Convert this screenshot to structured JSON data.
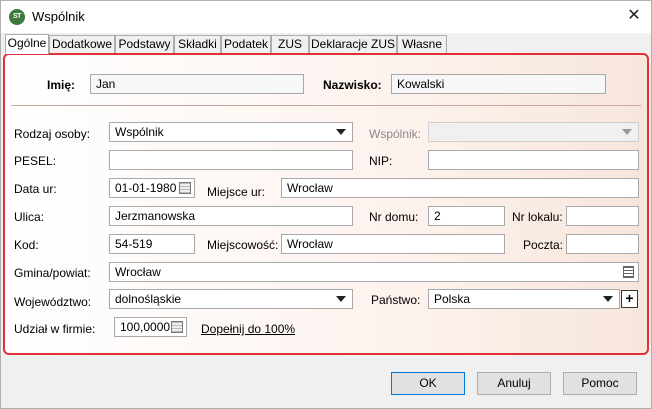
{
  "window": {
    "title": "Wspólnik",
    "icon_text": "ST"
  },
  "tabs": [
    {
      "label": "Ogólne"
    },
    {
      "label": "Dodatkowe"
    },
    {
      "label": "Podstawy"
    },
    {
      "label": "Składki"
    },
    {
      "label": "Podatek"
    },
    {
      "label": "ZUS"
    },
    {
      "label": "Deklaracje ZUS"
    },
    {
      "label": "Własne"
    }
  ],
  "form": {
    "imie": {
      "label": "Imię:",
      "value": "Jan"
    },
    "nazwisko": {
      "label": "Nazwisko:",
      "value": "Kowalski"
    },
    "rodzaj_osoby": {
      "label": "Rodzaj osoby:",
      "value": "Wspólnik"
    },
    "wspolnik": {
      "label": "Wspólnik:",
      "value": ""
    },
    "pesel": {
      "label": "PESEL:",
      "value": ""
    },
    "nip": {
      "label": "NIP:",
      "value": ""
    },
    "data_ur": {
      "label": "Data ur:",
      "value": "01-01-1980"
    },
    "miejsce_ur": {
      "label": "Miejsce ur:",
      "value": "Wrocław"
    },
    "ulica": {
      "label": "Ulica:",
      "value": "Jerzmanowska"
    },
    "nr_domu": {
      "label": "Nr domu:",
      "value": "2"
    },
    "nr_lokalu": {
      "label": "Nr lokalu:",
      "value": ""
    },
    "kod": {
      "label": "Kod:",
      "value": "54-519"
    },
    "miejscowosc": {
      "label": "Miejscowość:",
      "value": "Wrocław"
    },
    "poczta": {
      "label": "Poczta:",
      "value": ""
    },
    "gmina": {
      "label": "Gmina/powiat:",
      "value": "Wrocław"
    },
    "wojewodztwo": {
      "label": "Województwo:",
      "value": "dolnośląskie"
    },
    "panstwo": {
      "label": "Państwo:",
      "value": "Polska"
    },
    "udzial": {
      "label": "Udział w firmie:",
      "value": "100,0000"
    },
    "dopelnij_link": "Dopełnij do 100%"
  },
  "buttons": {
    "ok": "OK",
    "anuluj": "Anuluj",
    "pomoc": "Pomoc"
  },
  "colors": {
    "panel_border": "#e0303a",
    "default_button_border": "#0078d7"
  }
}
